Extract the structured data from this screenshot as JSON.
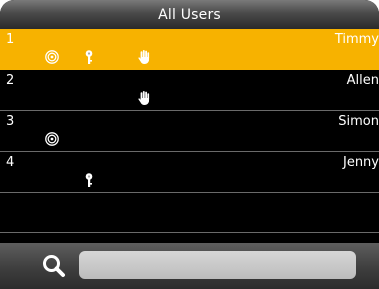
{
  "header": {
    "title": "All Users"
  },
  "users": [
    {
      "id": "1",
      "name": "Timmy",
      "selected": true,
      "fingerprint": true,
      "password": true,
      "palm": true
    },
    {
      "id": "2",
      "name": "Allen",
      "selected": false,
      "fingerprint": false,
      "password": false,
      "palm": true
    },
    {
      "id": "3",
      "name": "Simon",
      "selected": false,
      "fingerprint": true,
      "password": false,
      "palm": false
    },
    {
      "id": "4",
      "name": "Jenny",
      "selected": false,
      "fingerprint": false,
      "password": true,
      "palm": false
    }
  ],
  "icons": {
    "fingerprint": "fingerprint-icon",
    "password": "key-icon",
    "palm": "palm-icon"
  },
  "search": {
    "value": "",
    "placeholder": ""
  },
  "colors": {
    "selected_row": "#f7b200",
    "background": "#000000",
    "text": "#ffffff"
  }
}
